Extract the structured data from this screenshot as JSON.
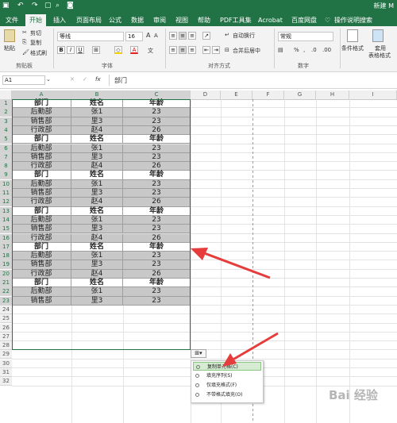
{
  "titlebar": {
    "title": "新建 M"
  },
  "tabs": [
    "文件",
    "开始",
    "插入",
    "页面布局",
    "公式",
    "数据",
    "审阅",
    "视图",
    "帮助",
    "PDF工具集",
    "Acrobat",
    "百度网盘",
    "操作说明搜索"
  ],
  "ribbon": {
    "paste_label": "粘贴",
    "cut_label": "剪切",
    "copy_label": "复制",
    "format_painter_label": "格式刷",
    "clipboard_group": "剪贴板",
    "font_name": "等线",
    "font_size": "16",
    "font_group": "字体",
    "wrap_text": "自动换行",
    "merge_center": "合并后居中",
    "alignment_group": "对齐方式",
    "number_format": "常规",
    "number_group": "数字",
    "conditional_format": "条件格式",
    "table_format_1": "套用",
    "table_format_2": "表格格式"
  },
  "formula_bar": {
    "name_box": "A1",
    "fx": "fx",
    "content": "部门"
  },
  "columns": [
    "A",
    "B",
    "C",
    "D",
    "E",
    "F",
    "G",
    "H",
    "I"
  ],
  "rows": [
    "1",
    "2",
    "3",
    "4",
    "5",
    "6",
    "7",
    "8",
    "9",
    "10",
    "11",
    "12",
    "13",
    "14",
    "15",
    "16",
    "17",
    "18",
    "19",
    "20",
    "21",
    "22",
    "23",
    "24",
    "25",
    "26",
    "27",
    "28",
    "29",
    "30",
    "31",
    "32"
  ],
  "table": [
    [
      "部门",
      "姓名",
      "年龄"
    ],
    [
      "后勤部",
      "张1",
      "23"
    ],
    [
      "销售部",
      "里3",
      "23"
    ],
    [
      "行政部",
      "赵4",
      "26"
    ],
    [
      "部门",
      "姓名",
      "年龄"
    ],
    [
      "后勤部",
      "张1",
      "23"
    ],
    [
      "销售部",
      "里3",
      "23"
    ],
    [
      "行政部",
      "赵4",
      "26"
    ],
    [
      "部门",
      "姓名",
      "年龄"
    ],
    [
      "后勤部",
      "张1",
      "23"
    ],
    [
      "销售部",
      "里3",
      "23"
    ],
    [
      "行政部",
      "赵4",
      "26"
    ],
    [
      "部门",
      "姓名",
      "年龄"
    ],
    [
      "后勤部",
      "张1",
      "23"
    ],
    [
      "销售部",
      "里3",
      "23"
    ],
    [
      "行政部",
      "赵4",
      "26"
    ],
    [
      "部门",
      "姓名",
      "年龄"
    ],
    [
      "后勤部",
      "张1",
      "23"
    ],
    [
      "销售部",
      "里3",
      "23"
    ],
    [
      "行政部",
      "赵4",
      "26"
    ],
    [
      "部门",
      "姓名",
      "年龄"
    ],
    [
      "后勤部",
      "张1",
      "23"
    ],
    [
      "销售部",
      "里3",
      "23"
    ]
  ],
  "paste_menu": {
    "items": [
      "复制单元格(C)",
      "填充序列(S)",
      "仅填充格式(F)",
      "不带格式填充(O)"
    ],
    "active_index": 0
  },
  "watermark": "Bai 经验",
  "colors": {
    "excel_green": "#217346",
    "selection_gray": "#c8c8c8",
    "arrow_red": "#e63c3c"
  }
}
